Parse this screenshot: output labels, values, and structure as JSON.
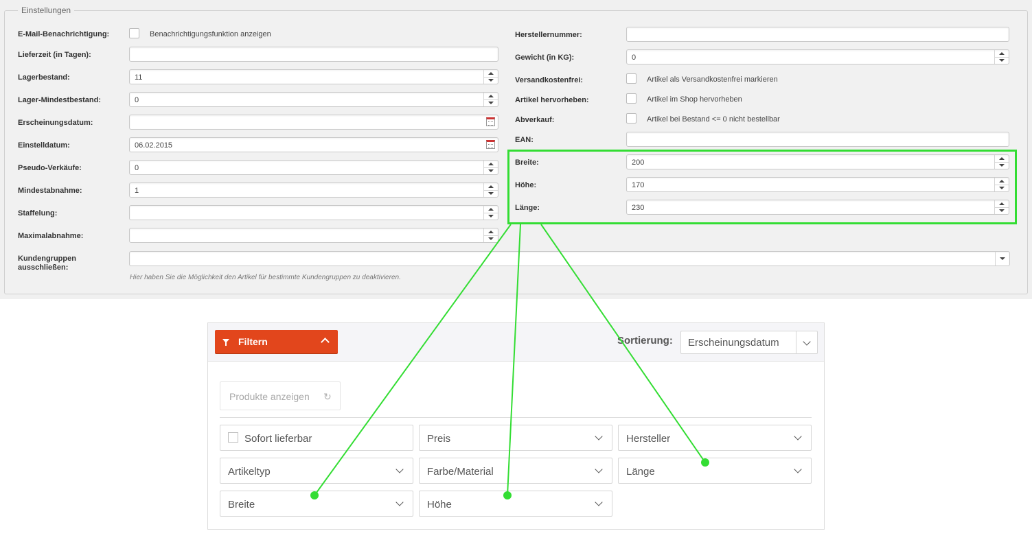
{
  "settings": {
    "legend": "Einstellungen",
    "left": {
      "email_label": "E-Mail-Benachrichtigung:",
      "email_checkbox_text": "Benachrichtigungsfunktion anzeigen",
      "lieferzeit_label": "Lieferzeit (in Tagen):",
      "lieferzeit_value": "",
      "lagerbestand_label": "Lagerbestand:",
      "lagerbestand_value": "11",
      "lager_min_label": "Lager-Mindestbestand:",
      "lager_min_value": "0",
      "erscheinungsdatum_label": "Erscheinungsdatum:",
      "erscheinungsdatum_value": "",
      "einstelldatum_label": "Einstelldatum:",
      "einstelldatum_value": "06.02.2015",
      "pseudo_label": "Pseudo-Verkäufe:",
      "pseudo_value": "0",
      "mindestabnahme_label": "Mindestabnahme:",
      "mindestabnahme_value": "1",
      "staffelung_label": "Staffelung:",
      "staffelung_value": "",
      "maximalabnahme_label": "Maximalabnahme:",
      "maximalabnahme_value": "",
      "kundengruppen_label_1": "Kundengruppen",
      "kundengruppen_label_2": "ausschließen:",
      "kundengruppen_value": "",
      "kundengruppen_hint": "Hier haben Sie die Möglichkeit den Artikel für bestimmte Kundengruppen zu deaktivieren."
    },
    "right": {
      "herstellernummer_label": "Herstellernummer:",
      "herstellernummer_value": "",
      "gewicht_label": "Gewicht (in KG):",
      "gewicht_value": "0",
      "versandkostenfrei_label": "Versandkostenfrei:",
      "versandkostenfrei_text": "Artikel als Versandkostenfrei markieren",
      "hervorheben_label": "Artikel hervorheben:",
      "hervorheben_text": "Artikel im Shop hervorheben",
      "abverkauf_label": "Abverkauf:",
      "abverkauf_text": "Artikel bei Bestand <= 0 nicht bestellbar",
      "ean_label": "EAN:",
      "ean_value": "",
      "breite_label": "Breite:",
      "breite_value": "200",
      "hoehe_label": "Höhe:",
      "hoehe_value": "170",
      "laenge_label": "Länge:",
      "laenge_value": "230"
    }
  },
  "filter_panel": {
    "filter_button": "Filtern",
    "sort_label": "Sortierung:",
    "sort_value": "Erscheinungsdatum",
    "show_products": "Produkte anzeigen",
    "refresh_glyph": "↻",
    "filters": {
      "sofort": "Sofort lieferbar",
      "preis": "Preis",
      "hersteller": "Hersteller",
      "artikeltyp": "Artikeltyp",
      "farbe": "Farbe/Material",
      "laenge": "Länge",
      "breite": "Breite",
      "hoehe": "Höhe"
    }
  },
  "colors": {
    "highlight": "#33dd33",
    "filter_button": "#e2461c"
  }
}
